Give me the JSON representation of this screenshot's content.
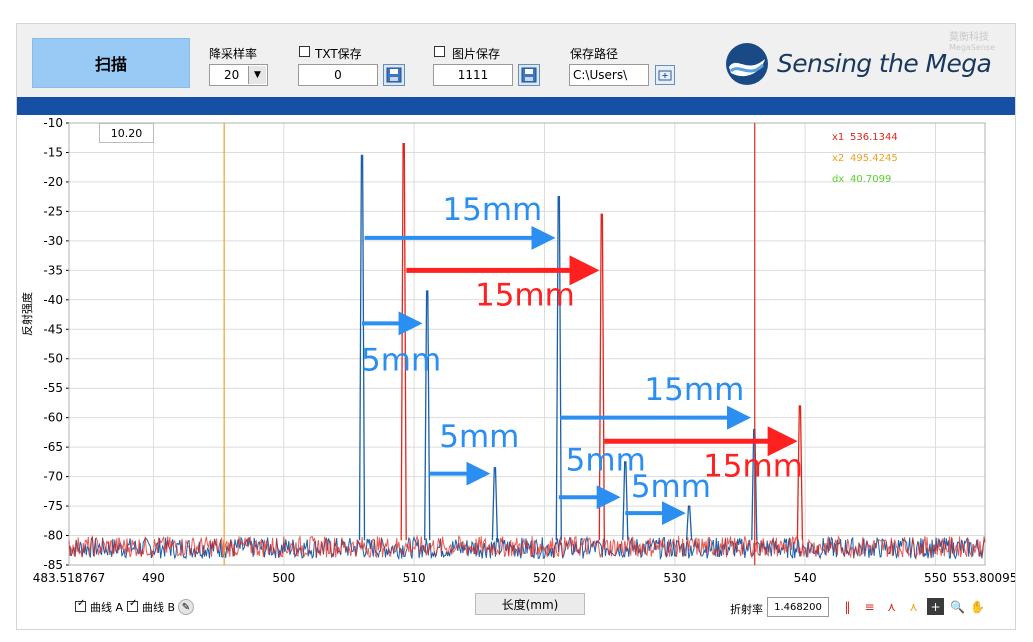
{
  "toolbar": {
    "scan_label": "扫描",
    "downsample_label": "降采样率",
    "downsample_value": "20",
    "txt_save_label": "TXT保存",
    "txt_save_value": "0",
    "img_save_label": "图片保存",
    "img_save_value": "1111",
    "save_path_label": "保存路径",
    "save_path_value": "C:\\Users\\"
  },
  "brand": {
    "name": "Sensing the Mega",
    "watermark_top": "莫衡科技",
    "watermark_bottom": "MegaSense"
  },
  "cursor_box": "10.20",
  "cursor_readout": [
    {
      "label": "x1",
      "value": "536.1344",
      "color": "#e0261c"
    },
    {
      "label": "x2",
      "value": "495.4245",
      "color": "#f0a020"
    },
    {
      "label": "dx",
      "value": "40.7099",
      "color": "#5ad02a"
    }
  ],
  "bottom": {
    "curve_a": "曲线 A",
    "curve_b": "曲线 B",
    "xlabel_box": "长度(mm)",
    "refr_label": "折射率",
    "refr_value": "1.468200"
  },
  "colors": {
    "blue_series": "#1b5fa8",
    "red_series": "#e0261c",
    "orange_cursor": "#f0a020",
    "arrow_blue": "#2a8ff0",
    "arrow_red": "#ff2020",
    "header_bar": "#1650a2"
  },
  "chart_data": {
    "type": "line",
    "xlabel": "长度(mm)",
    "ylabel": "反射强度",
    "xlim": [
      483.518767,
      553.80095
    ],
    "ylim": [
      -85,
      -10
    ],
    "x_ticks": [
      "483.518767",
      "490",
      "500",
      "510",
      "520",
      "530",
      "540",
      "550",
      "553.80095"
    ],
    "x_tick_values": [
      483.518767,
      490,
      500,
      510,
      520,
      530,
      540,
      550,
      553.80095
    ],
    "y_ticks": [
      -10,
      -15,
      -20,
      -25,
      -30,
      -35,
      -40,
      -45,
      -50,
      -55,
      -60,
      -65,
      -70,
      -75,
      -80,
      -85
    ],
    "grid": true,
    "noise_floor": -82,
    "series": [
      {
        "name": "曲线 A",
        "color": "#1b5fa8",
        "peaks": [
          {
            "x": 506.0,
            "y": -15.5
          },
          {
            "x": 511.0,
            "y": -38.5
          },
          {
            "x": 516.2,
            "y": -68.5
          },
          {
            "x": 521.1,
            "y": -22.5
          },
          {
            "x": 526.2,
            "y": -67.5
          },
          {
            "x": 531.1,
            "y": -75.0
          },
          {
            "x": 536.1,
            "y": -62.0
          }
        ]
      },
      {
        "name": "曲线 B",
        "color": "#e0261c",
        "peaks": [
          {
            "x": 509.2,
            "y": -13.5
          },
          {
            "x": 524.4,
            "y": -25.5
          },
          {
            "x": 539.6,
            "y": -58.0
          }
        ]
      }
    ],
    "cursors": [
      {
        "name": "x1",
        "x": 536.1344,
        "color": "#e0261c"
      },
      {
        "name": "x2",
        "x": 495.4245,
        "color": "#f0a020"
      }
    ],
    "annotations": [
      {
        "text": "15mm",
        "color": "#2a8ff0",
        "x1": 506.2,
        "x2": 521.0,
        "y": -29.5,
        "tx": 516.0,
        "ty": -26.5
      },
      {
        "text": "15mm",
        "color": "#ff2020",
        "x1": 509.4,
        "x2": 524.3,
        "y": -35.0,
        "tx": 518.5,
        "ty": -41.0
      },
      {
        "text": "5mm",
        "color": "#2a8ff0",
        "x1": 506.0,
        "x2": 510.8,
        "y": -44.0,
        "tx": 509.0,
        "ty": -52.0
      },
      {
        "text": "5mm",
        "color": "#2a8ff0",
        "x1": 511.2,
        "x2": 516.0,
        "y": -69.5,
        "tx": 515.0,
        "ty": -65.0
      },
      {
        "text": "15mm",
        "color": "#2a8ff0",
        "x1": 521.2,
        "x2": 536.0,
        "y": -60.0,
        "tx": 531.5,
        "ty": -57.0
      },
      {
        "text": "15mm",
        "color": "#ff2020",
        "x1": 524.6,
        "x2": 539.5,
        "y": -64.0,
        "tx": 536.0,
        "ty": -70.0
      },
      {
        "text": "5mm",
        "color": "#2a8ff0",
        "x1": 521.1,
        "x2": 526.0,
        "y": -73.5,
        "tx": 524.7,
        "ty": -69.0
      },
      {
        "text": "5mm",
        "color": "#2a8ff0",
        "x1": 526.2,
        "x2": 531.0,
        "y": -76.2,
        "tx": 529.7,
        "ty": -73.5
      }
    ]
  }
}
